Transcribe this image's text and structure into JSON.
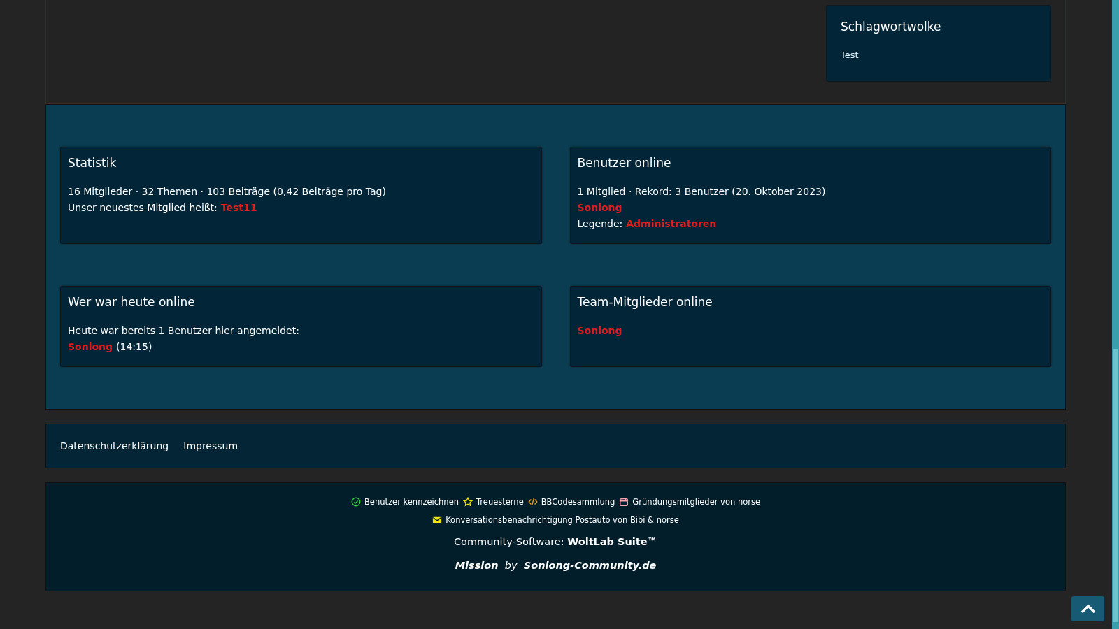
{
  "sidebar_box": {
    "title": "Schlagwortwolke",
    "tags": [
      "Test"
    ]
  },
  "boxes": [
    {
      "title": "Statistik",
      "lines": [
        [
          {
            "kind": "text",
            "text": "16 Mitglieder · 32 Themen · 103 Beiträge (0,42 Beiträge pro Tag)"
          }
        ],
        [
          {
            "kind": "text",
            "text": "Unser neuestes Mitglied heißt:"
          },
          {
            "kind": "link",
            "text": "Test11"
          }
        ]
      ]
    },
    {
      "title": "Benutzer online",
      "lines": [
        [
          {
            "kind": "text",
            "text": "1 Mitglied · Rekord: 3 Benutzer (20. Oktober 2023)"
          }
        ],
        [
          {
            "kind": "link",
            "text": "Sonlong"
          }
        ],
        [
          {
            "kind": "text",
            "text": "Legende:"
          },
          {
            "kind": "link",
            "text": "Administratoren"
          }
        ]
      ]
    },
    {
      "title": "Wer war heute online",
      "lines": [
        [
          {
            "kind": "text",
            "text": "Heute war bereits 1 Benutzer hier angemeldet:"
          }
        ],
        [
          {
            "kind": "link",
            "text": "Sonlong"
          },
          {
            "kind": "text",
            "text": "(14:15)"
          }
        ]
      ]
    },
    {
      "title": "Team-Mitglieder online",
      "lines": [
        [
          {
            "kind": "link",
            "text": "Sonlong"
          }
        ]
      ]
    }
  ],
  "footer_links": [
    "Datenschutzerklärung",
    "Impressum"
  ],
  "credits": [
    {
      "kind": "check",
      "color": "#2ecc40",
      "label": "Benutzer kennzeichnen"
    },
    {
      "kind": "star",
      "color": "#f1e30f",
      "label": "Treuesterne"
    },
    {
      "kind": "code",
      "color": "#f39c12",
      "label": "BBCodesammlung"
    },
    {
      "kind": "calendar",
      "color": "#f4a7b0",
      "label": "Gründungsmitglieder von norse"
    },
    {
      "kind": "envelope",
      "color": "#f1e30f",
      "label": "Konversationsbenachrichtigung Postauto von Bibi & norse"
    }
  ],
  "copyright": "Community-Software: **WoltLab Suite™**",
  "mission": "**Mission**  by  **Sonlong-Community.de**"
}
